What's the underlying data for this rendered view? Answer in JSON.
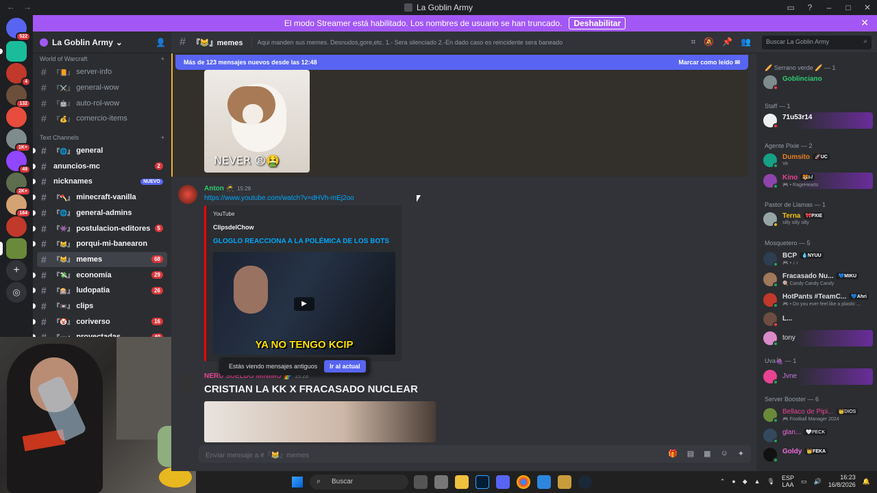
{
  "window": {
    "title": "La Goblin Army"
  },
  "banner": {
    "text": "El modo Streamer está habilitado. Los nombres de usuario se han truncado.",
    "button": "Deshabilitar"
  },
  "servers": [
    {
      "badge": "522",
      "color": "#5865f2"
    },
    {
      "badge": "",
      "color": "#1abc9c"
    },
    {
      "badge": "4",
      "color": "#c0392b"
    },
    {
      "badge": "132",
      "color": "#6b4f3a"
    },
    {
      "badge": "",
      "color": "#e74c3c"
    },
    {
      "badge": "1K+",
      "color": "#7f8c8d"
    },
    {
      "badge": "49",
      "color": "#9146ff"
    },
    {
      "badge": "2K+",
      "color": "#5d6d4e"
    },
    {
      "badge": "164",
      "color": "#d4a373"
    },
    {
      "badge": "",
      "color": "#c0392b"
    },
    {
      "badge": "",
      "color": "#6a8a3a"
    }
  ],
  "guild": {
    "name": "La Goblin Army"
  },
  "categories": {
    "wow": "World of Warcraft",
    "text": "Text Channels"
  },
  "wow_channels": [
    {
      "emoji": "『📙』",
      "name": "server-info"
    },
    {
      "emoji": "『⚔️』",
      "name": "general-wow"
    },
    {
      "emoji": "『🤖』",
      "name": "auto-rol-wow"
    },
    {
      "emoji": "『💰』",
      "name": "comercio-items"
    }
  ],
  "text_channels": [
    {
      "emoji": "『🌐』",
      "name": "general",
      "count": ""
    },
    {
      "emoji": "",
      "name": "anuncios-mc",
      "count": "2"
    },
    {
      "emoji": "",
      "name": "nicknames",
      "new": "NUEVO"
    },
    {
      "emoji": "『🪓』",
      "name": "minecraft-vanilla",
      "count": ""
    },
    {
      "emoji": "『🌐』",
      "name": "general-admins",
      "count": ""
    },
    {
      "emoji": "『👾』",
      "name": "postulacion-editores",
      "count": "5"
    },
    {
      "emoji": "『😹』",
      "name": "porqui-mi-banearon",
      "count": ""
    },
    {
      "emoji": "『😹』",
      "name": "memes",
      "count": "68"
    },
    {
      "emoji": "『💸』",
      "name": "economía",
      "count": "29"
    },
    {
      "emoji": "『🎰』",
      "name": "ludopatia",
      "count": "26"
    },
    {
      "emoji": "『📼』",
      "name": "clips",
      "count": ""
    },
    {
      "emoji": "『🤡』",
      "name": "coriverso",
      "count": "16"
    },
    {
      "emoji": "『📺』",
      "name": "proyectadas",
      "count": "40"
    }
  ],
  "topbar": {
    "channel": "『😹』memes",
    "topic": "Aqui manden sus memes. Desnudos,gore,etc. 1.- Sera silenciado 2.-En dado caso es reincidente sera baneado",
    "search": "Buscar La Goblin Army"
  },
  "newbar": {
    "text": "Más de 123 mensajes nuevos desde las 12:48",
    "action": "Marcar como leído"
  },
  "messages": {
    "gif_caption": "NEVER 😫🤮",
    "anton": {
      "author": "Anton 🥷",
      "time": "15:28",
      "link": "https://www.youtube.com/watch?v=dHVh-mEj2oo"
    },
    "embed": {
      "provider": "YouTube",
      "channel": "ClipsdelChow",
      "title": "GLOGLO REACCIONA A LA POLÉMICA DE LOS BOTS",
      "thumb_text": "YA NO TENGO KCIP"
    },
    "neru": {
      "author": "NERU SUELDO MINIMO 🌈",
      "time": "15:28",
      "text": "CRISTIAN LA KK X FRACASADO NUCLEAR"
    }
  },
  "old_notice": {
    "text": "Estás viendo mensajes antiguos",
    "button": "Ir al actual"
  },
  "composer": {
    "placeholder": "Enviar mensaje a #『😹』memes"
  },
  "members": [
    {
      "role": "🥖 Serrano verde 🥖 — 1"
    },
    {
      "name": "Goblinciano",
      "color": "#2ecc71"
    },
    {
      "role": "Staff — 1"
    },
    {
      "name": "71u53r14",
      "color": "#ffffff",
      "sub": ""
    },
    {
      "role": "Agente Pixie — 2"
    },
    {
      "name": "Dumsito",
      "tag": "🚀UC",
      "color": "#e67e22",
      "sub": "Ve"
    },
    {
      "name": "Kino",
      "tag": "🐯I-/",
      "color": "#e84393",
      "sub": "🎮 • RageHearts"
    },
    {
      "role": "Pastor de Llamas — 1"
    },
    {
      "name": "Terna",
      "tag": "🎀PXIE",
      "color": "#f1c40f",
      "sub": "silly silly silly"
    },
    {
      "role": "Mosquetero — 5"
    },
    {
      "name": "BCP",
      "tag": "💧NYUU",
      "color": "#dbdee1",
      "sub": "🎮 • ♪ ı"
    },
    {
      "name": "Fracasado Nu...",
      "tag": "💙MIKU",
      "color": "#dbdee1",
      "sub": "🍭 Candy Candy Candy"
    },
    {
      "name": "HotPants #TeamC...",
      "tag": "💙Ahri",
      "color": "#dbdee1",
      "sub": "🎮 • Do you ever feel like a plastic ..."
    },
    {
      "name": "L...",
      "color": "#dbdee1"
    },
    {
      "name": "tony",
      "color": "#dbdee1"
    },
    {
      "role": "Uva🍇 — 1"
    },
    {
      "name": "Jvne",
      "color": "#c678dd"
    },
    {
      "role": "Server Booster — 6"
    },
    {
      "name": "Bellaco de Pipi...",
      "tag": "👑DIOS",
      "color": "#e84393",
      "sub": "🎮 Football Manager 2024"
    },
    {
      "name": "glan...",
      "tag": "🤍PECK",
      "color": "#f368e0"
    },
    {
      "name": "Goldy",
      "tag": "👑FEKA",
      "color": "#f368e0"
    }
  ],
  "taskbar": {
    "search": "Buscar",
    "lang": "ESP",
    "lang2": "LAA",
    "time": "16:23",
    "date": "16/8/2026"
  }
}
